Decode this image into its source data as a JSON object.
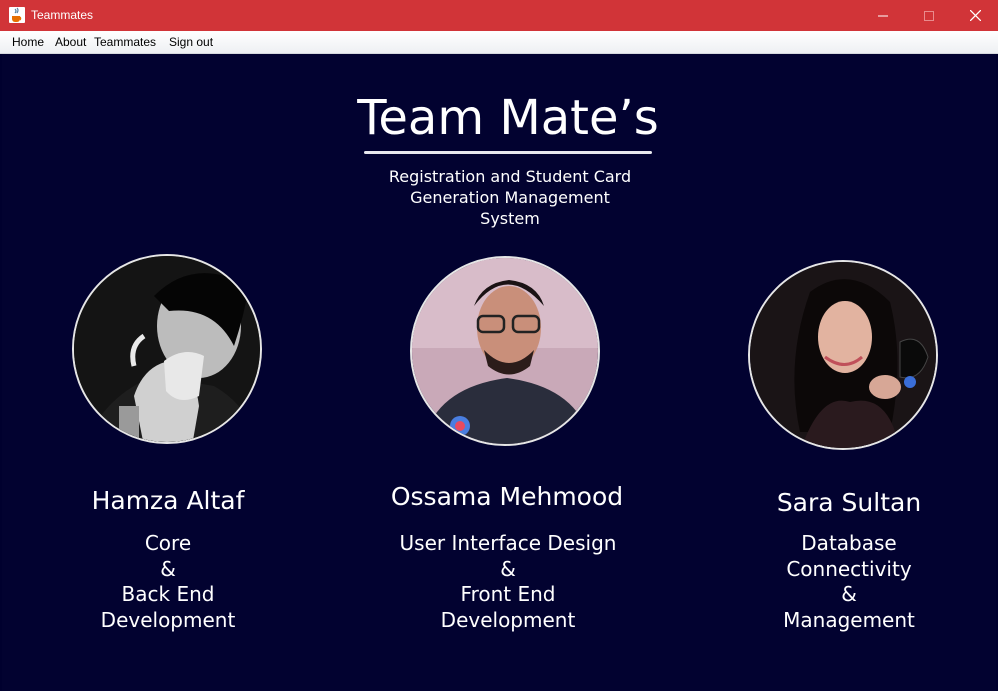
{
  "window": {
    "title": "Teammates",
    "icon": "java-coffee-icon"
  },
  "menu": [
    "Home",
    "About",
    "Teammates",
    "Sign out"
  ],
  "page": {
    "title": "Team Mate’s",
    "subtitle": [
      "Registration and Student Card",
      "Generation Management",
      "System"
    ]
  },
  "members": [
    {
      "name": "Hamza Altaf",
      "role": [
        "Core",
        "&",
        "Back End",
        "Development"
      ]
    },
    {
      "name": "Ossama Mehmood",
      "role": [
        "User Interface Design",
        "&",
        "Front End",
        "Development"
      ]
    },
    {
      "name": "Sara Sultan",
      "role": [
        "Database",
        "Connectivity",
        "&",
        "Management"
      ]
    }
  ],
  "colors": {
    "titlebar": "#d13438",
    "background": "#020230",
    "text": "#ffffff"
  }
}
